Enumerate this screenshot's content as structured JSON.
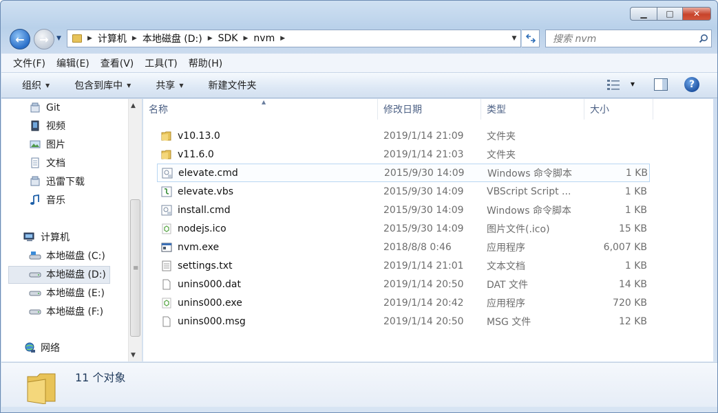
{
  "address": {
    "crumbs": [
      "计算机",
      "本地磁盘 (D:)",
      "SDK",
      "nvm"
    ]
  },
  "search": {
    "placeholder": "搜索 nvm"
  },
  "menu": [
    "文件(F)",
    "编辑(E)",
    "查看(V)",
    "工具(T)",
    "帮助(H)"
  ],
  "commands": {
    "organize": "组织",
    "include": "包含到库中",
    "share": "共享",
    "new_folder": "新建文件夹"
  },
  "nav": {
    "libraries": [
      {
        "label": "Git",
        "icon": "git-library-icon"
      },
      {
        "label": "视频",
        "icon": "video-library-icon"
      },
      {
        "label": "图片",
        "icon": "pictures-library-icon"
      },
      {
        "label": "文档",
        "icon": "documents-library-icon"
      },
      {
        "label": "迅雷下载",
        "icon": "download-library-icon"
      },
      {
        "label": "音乐",
        "icon": "music-library-icon"
      }
    ],
    "computer": "计算机",
    "drives": [
      "本地磁盘 (C:)",
      "本地磁盘 (D:)",
      "本地磁盘 (E:)",
      "本地磁盘 (F:)"
    ],
    "network": "网络"
  },
  "columns": {
    "name": "名称",
    "date": "修改日期",
    "type": "类型",
    "size": "大小"
  },
  "files": [
    {
      "name": "v10.13.0",
      "date": "2019/1/14 21:09",
      "type": "文件夹",
      "size": "",
      "icon": "folder-icon"
    },
    {
      "name": "v11.6.0",
      "date": "2019/1/14 21:03",
      "type": "文件夹",
      "size": "",
      "icon": "folder-icon"
    },
    {
      "name": "elevate.cmd",
      "date": "2015/9/30 14:09",
      "type": "Windows 命令脚本",
      "size": "1 KB",
      "icon": "cmd-script-icon"
    },
    {
      "name": "elevate.vbs",
      "date": "2015/9/30 14:09",
      "type": "VBScript Script ...",
      "size": "1 KB",
      "icon": "vbs-script-icon"
    },
    {
      "name": "install.cmd",
      "date": "2015/9/30 14:09",
      "type": "Windows 命令脚本",
      "size": "1 KB",
      "icon": "cmd-script-icon"
    },
    {
      "name": "nodejs.ico",
      "date": "2015/9/30 14:09",
      "type": "图片文件(.ico)",
      "size": "15 KB",
      "icon": "nodejs-icon"
    },
    {
      "name": "nvm.exe",
      "date": "2018/8/8 0:46",
      "type": "应用程序",
      "size": "6,007 KB",
      "icon": "exe-icon"
    },
    {
      "name": "settings.txt",
      "date": "2019/1/14 21:01",
      "type": "文本文档",
      "size": "1 KB",
      "icon": "text-file-icon"
    },
    {
      "name": "unins000.dat",
      "date": "2019/1/14 20:50",
      "type": "DAT 文件",
      "size": "14 KB",
      "icon": "blank-file-icon"
    },
    {
      "name": "unins000.exe",
      "date": "2019/1/14 20:42",
      "type": "应用程序",
      "size": "720 KB",
      "icon": "nodejs-icon"
    },
    {
      "name": "unins000.msg",
      "date": "2019/1/14 20:50",
      "type": "MSG 文件",
      "size": "12 KB",
      "icon": "blank-file-icon"
    }
  ],
  "status": {
    "count_text": "11 个对象"
  },
  "colors": {
    "folder": "#e7c35a",
    "accent": "#2a6fc9",
    "close": "#c7432b"
  }
}
